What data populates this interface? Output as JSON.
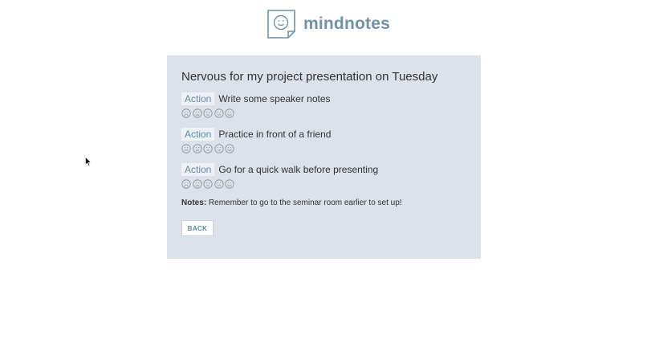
{
  "app": {
    "name": "mindnotes",
    "logo_icon": "note-smile-icon",
    "brand_color": "#6f92a6"
  },
  "entry": {
    "title": "Nervous for my project presentation on Tuesday",
    "actions": [
      {
        "tag": "Action",
        "text": "Write some speaker notes"
      },
      {
        "tag": "Action",
        "text": "Practice in front of a friend"
      },
      {
        "tag": "Action",
        "text": "Go for a quick walk before presenting"
      }
    ],
    "rating_icons": [
      "very-sad-face-icon",
      "sad-face-icon",
      "neutral-face-icon",
      "happy-face-icon",
      "very-happy-face-icon"
    ],
    "notes_label": "Notes:",
    "notes_text": "Remember to go to the seminar room earlier to set up!"
  },
  "buttons": {
    "back_label": "BACK"
  },
  "colors": {
    "card_background": "#dde2ea",
    "accent": "#5f8aa0"
  }
}
